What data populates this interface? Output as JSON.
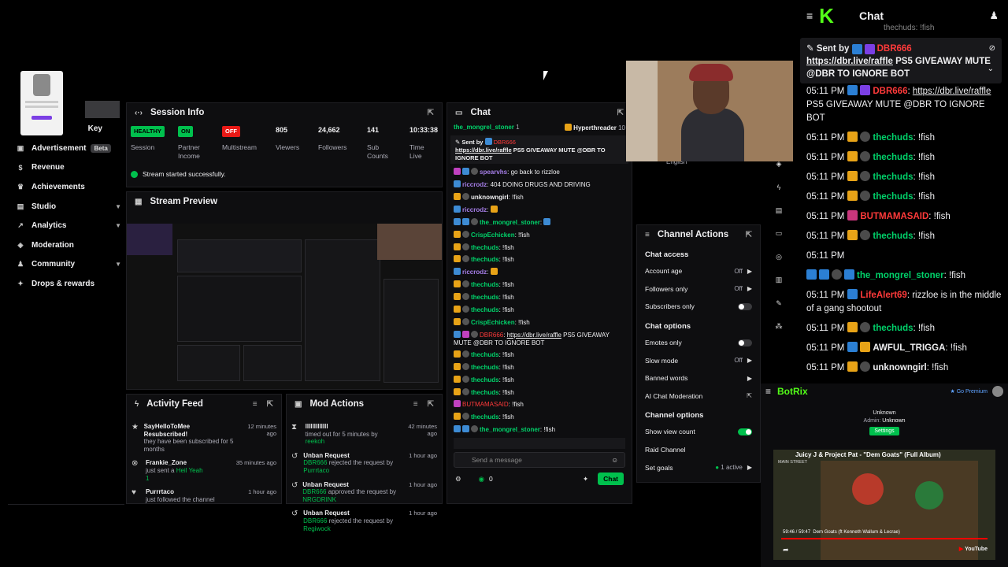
{
  "nav": {
    "items": [
      {
        "label": "Key",
        "icon": "key-icon",
        "y": "partial"
      },
      {
        "label": "Advertisement",
        "badge": "Beta"
      },
      {
        "label": "Revenue"
      },
      {
        "label": "Achievements"
      },
      {
        "label": "Studio"
      },
      {
        "label": "Analytics"
      },
      {
        "label": "Moderation"
      },
      {
        "label": "Community"
      },
      {
        "label": "Drops & rewards"
      }
    ]
  },
  "session": {
    "title": "Session Info",
    "stats": [
      {
        "pill": "HEALTHY",
        "label": "Session",
        "color": "#00c04d"
      },
      {
        "pill": "ON",
        "label": "Partner Income",
        "color": "#00c04d"
      },
      {
        "pill": "OFF",
        "label": "Multistream",
        "color": "#e91916"
      },
      {
        "value": "805",
        "label": "Viewers"
      },
      {
        "value": "24,662",
        "label": "Followers"
      },
      {
        "value": "141",
        "label": "Sub Counts"
      },
      {
        "value": "10:33:38",
        "label": "Time Live"
      }
    ],
    "notice": "Stream started successfully."
  },
  "preview": {
    "title": "Stream Preview"
  },
  "activity": {
    "title": "Activity Feed",
    "rows": [
      {
        "name": "SayHelloToMee",
        "action": "Resubscribed!",
        "detail": "they have been subscribed for 5 months",
        "ago": "12 minutes ago"
      },
      {
        "name": "Frankie_Zone",
        "action": "just sent a",
        "extra": "Heil Yeah",
        "count": "1",
        "ago": "35 minutes ago"
      },
      {
        "name": "Purrrtaco",
        "action": "just followed the channel",
        "ago": "1 hour ago"
      }
    ]
  },
  "mod": {
    "title": "Mod Actions",
    "rows": [
      {
        "name": "lllllllllllll",
        "detail": "timed out for 5 minutes by",
        "by": "reekoh",
        "ago": "42 minutes ago"
      },
      {
        "name": "Unban Request",
        "mod": "DBR666",
        "detail": "rejected the request by",
        "by": "Purrrtaco",
        "ago": "1 hour ago"
      },
      {
        "name": "Unban Request",
        "mod": "DBR666",
        "detail": "approved the request by",
        "by": "NRGDRINK",
        "ago": "1 hour ago"
      },
      {
        "name": "Unban Request",
        "mod": "DBR666",
        "detail": "rejected the request by",
        "by": "Regiwock",
        "ago": "1 hour ago"
      }
    ]
  },
  "chat": {
    "title": "Chat",
    "hype_user": "the_mongrel_stoner",
    "hype_user_count": "1",
    "hype_label": "Hyperthreader",
    "hype_count": "10",
    "pinned_label": "Sent by",
    "pinned_user": "DBR666",
    "pinned_link": "https://dbr.live/raffle",
    "pinned_text": "PS5 GIVEAWAY MUTE @DBR TO IGNORE BOT",
    "lines": [
      {
        "user": "spearvhs",
        "msg": "go back to rizzloe",
        "color": "purple"
      },
      {
        "user": "riccrodz",
        "msg": "404  DOING DRUGS AND DRIVING",
        "color": "purple"
      },
      {
        "user": "unknowngirl",
        "msg": "!fish",
        "color": "white"
      },
      {
        "user": "riccrodz",
        "msg": "",
        "color": "purple"
      },
      {
        "user": "the_mongrel_stoner",
        "msg": "",
        "color": "green"
      },
      {
        "user": "CrispEchicken",
        "msg": "!fish",
        "color": "green"
      },
      {
        "user": "thechuds",
        "msg": "!fish",
        "color": "green"
      },
      {
        "user": "thechuds",
        "msg": "!fish",
        "color": "green"
      },
      {
        "user": "riccrodz",
        "msg": "",
        "color": "purple"
      },
      {
        "user": "thechuds",
        "msg": "!fish",
        "color": "green"
      },
      {
        "user": "thechuds",
        "msg": "!fish",
        "color": "green"
      },
      {
        "user": "thechuds",
        "msg": "!fish",
        "color": "green"
      },
      {
        "user": "CrispEchicken",
        "msg": "!fish",
        "color": "green"
      }
    ],
    "raffle_user": "DBR666",
    "raffle_link": "https://dbr.live/raffle",
    "raffle_text": "PS5 GIVEAWAY MUTE @DBR TO IGNORE BOT",
    "lines2": [
      {
        "user": "thechuds",
        "msg": "!fish",
        "color": "green"
      },
      {
        "user": "thechuds",
        "msg": "!fish",
        "color": "green"
      },
      {
        "user": "thechuds",
        "msg": "!fish",
        "color": "green"
      },
      {
        "user": "thechuds",
        "msg": "!fish",
        "color": "green"
      },
      {
        "user": "BUTMAMASAID",
        "msg": "!fish",
        "color": "red"
      },
      {
        "user": "thechuds",
        "msg": "!fish",
        "color": "green"
      },
      {
        "user": "the_mongrel_stoner",
        "msg": "!fish",
        "color": "green"
      }
    ],
    "placeholder": "Send a message",
    "points": "0",
    "send_label": "Chat"
  },
  "channel_actions": {
    "title": "Channel Actions",
    "language": "English",
    "access_head": "Chat access",
    "access": [
      {
        "label": "Account age",
        "value": "Off",
        "kind": "arrow"
      },
      {
        "label": "Followers only",
        "value": "Off",
        "kind": "arrow"
      },
      {
        "label": "Subscribers only",
        "kind": "toggle-off"
      }
    ],
    "options_head": "Chat options",
    "options": [
      {
        "label": "Emotes only",
        "kind": "toggle-off"
      },
      {
        "label": "Slow mode",
        "value": "Off",
        "kind": "arrow"
      },
      {
        "label": "Banned words",
        "kind": "arrow"
      },
      {
        "label": "AI Chat Moderation",
        "kind": "external"
      }
    ],
    "channel_head": "Channel options",
    "channel": [
      {
        "label": "Show view count",
        "kind": "toggle-on"
      },
      {
        "label": "Raid Channel",
        "kind": "none"
      },
      {
        "label": "Set goals",
        "value": "1 active",
        "kind": "arrow"
      }
    ]
  },
  "right_chat": {
    "title": "Chat",
    "partial_top": "thechuds: !fish",
    "pinned_label": "Sent by",
    "pinned_user": "DBR666",
    "pinned_link": "https://dbr.live/raffle",
    "pinned_text": "PS5 GIVEAWAY MUTE @DBR TO IGNORE BOT",
    "first": {
      "time": "05:11 PM",
      "user": "DBR666",
      "link": "https://dbr.live/raffle",
      "text": "PS5 GIVEAWAY MUTE @DBR TO IGNORE BOT"
    },
    "lines": [
      {
        "time": "05:11 PM",
        "user": "thechuds",
        "msg": "!fish",
        "color": "green"
      },
      {
        "time": "05:11 PM",
        "user": "thechuds",
        "msg": "!fish",
        "color": "green"
      },
      {
        "time": "05:11 PM",
        "user": "thechuds",
        "msg": "!fish",
        "color": "green"
      },
      {
        "time": "05:11 PM",
        "user": "thechuds",
        "msg": "!fish",
        "color": "green"
      },
      {
        "time": "05:11 PM",
        "user": "BUTMAMASAID",
        "msg": "!fish",
        "color": "red"
      },
      {
        "time": "05:11 PM",
        "user": "thechuds",
        "msg": "!fish",
        "color": "green"
      },
      {
        "time": "05:11 PM",
        "user": "",
        "msg": "",
        "color": "white"
      }
    ],
    "mongrel": {
      "user": "the_mongrel_stoner",
      "msg": "!fish"
    },
    "lifealert": {
      "time": "05:11 PM",
      "user": "LifeAlert69",
      "msg": "rizzloe is in the middle of a gang shootout"
    },
    "lines2": [
      {
        "time": "05:11 PM",
        "user": "thechuds",
        "msg": "!fish",
        "color": "green"
      },
      {
        "time": "05:11 PM",
        "user": "AWFUL_TRIGGA",
        "msg": "!fish",
        "color": "white"
      },
      {
        "time": "05:11 PM",
        "user": "unknowngirl",
        "msg": "!fish",
        "color": "white"
      }
    ]
  },
  "botrix": {
    "brand": "BotRix",
    "premium": "Go Premium",
    "user": "Unknown",
    "admin_label": "Admin:",
    "admin_value": "Unknown",
    "settings": "Settings"
  },
  "video": {
    "title": "Juicy J & Project Pat - \"Dem Goats\" (Full Album)",
    "channel": "MAIN STREET",
    "time": "59:46 / 59:47",
    "track": "Dem Goats (ft Kenneth Wallum & Lecrae)",
    "platform": "YouTube"
  },
  "colors": {
    "accent": "#00c04d",
    "bg": "#0e0e10",
    "gold": "#e8a317"
  }
}
